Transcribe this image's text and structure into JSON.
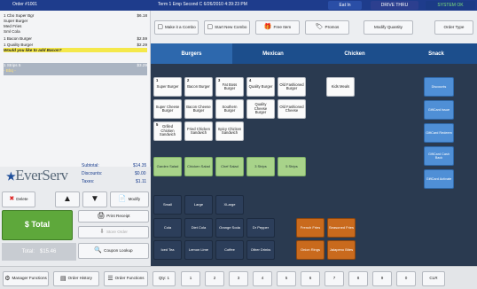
{
  "top": {
    "order_number": "Order #1001",
    "terminal": "Term 1 Emp Second C 6/26/2010 4:39:23 PM",
    "eat_in": "Eat In",
    "drive_thru": "DRIVE THRU",
    "system_ok": "SYSTEM OK"
  },
  "order_lines": [
    {
      "text": "1 Cbo Super Bgr",
      "price": "$6.18"
    },
    {
      "text": "  Super Burger",
      "price": ""
    },
    {
      "text": "  Med Fries",
      "price": ""
    },
    {
      "text": "  Sml Cola",
      "price": ""
    },
    {
      "text": "1 Bacon Burger",
      "price": "$2.59"
    },
    {
      "text": "1 Quality Burger",
      "price": "$2.29"
    },
    {
      "text": "  Would you like to add Bacon?",
      "price": ""
    },
    {
      "text": "1 Strips 5",
      "price": "$3.29"
    },
    {
      "text": "  - Bbq -",
      "price": ""
    }
  ],
  "logo": "EverServ",
  "totals": {
    "subtotal_label": "Subtotal:",
    "subtotal": "$14.35",
    "discounts_label": "Discounts:",
    "discounts": "$0.00",
    "taxes_label": "Taxes:",
    "taxes": "$1.11"
  },
  "left_actions": {
    "delete": "Delete",
    "modify": "Modify",
    "print_receipt": "Print Receipt",
    "store_order": "Store Order",
    "coupon_lookup": "Coupon Lookup",
    "total_button": "$ Total",
    "total_label": "Total:",
    "total_value": "$15.46"
  },
  "toolbar": {
    "make_combo": "Make it a Combo",
    "start_new_combo": "Start New Combo",
    "free_item": "Free Item",
    "promos": "Promos",
    "modify_quantity": "Modify Quantity",
    "order_type": "Order Type"
  },
  "tabs": [
    "Burgers",
    "Mexican",
    "Chicken",
    "Snack"
  ],
  "menu_items": {
    "super_burger": "Super Burger",
    "bacon_burger": "Bacon Burger",
    "fat_boss_burger": "Fat Boss Burger",
    "quality_burger": "Quality Burger",
    "old_fashioned_burger": "Old Fashioned Burger",
    "kids_meals": "Kids Meals",
    "super_cheese": "Super Cheese Burger",
    "bacon_cheese": "Bacon Cheese Burger",
    "southern_burger": "Southern Burger",
    "quality_cheese": "Quality Cheese Burger",
    "old_fashioned_cheese": "Old Fashioned Cheese",
    "grilled_chicken": "Grilled Chicken Sandwich",
    "fried_chicken": "Fried Chicken Sandwich",
    "spicy_chicken": "Spicy Chicken Sandwich",
    "garden_salad": "Garden Salad",
    "chicken_salad": "Chicken Salad",
    "chef_salad": "Chef Salad",
    "strips3": "3 Strips",
    "strips5": "5 Strips",
    "small": "Small",
    "large": "Large",
    "xlarge": "XLarge",
    "cola": "Cola",
    "diet_cola": "Diet Cola",
    "orange_soda": "Orange Soda",
    "dr_pepper": "Dr Pepper",
    "iced_tea": "Iced Tea",
    "lemon_lime": "Lemon Lime",
    "coffee": "Coffee",
    "other_drinks": "Other Drinks",
    "french_fries": "French Fries",
    "seasoned_fries": "Seasoned Fries",
    "onion_rings": "Onion Rings",
    "jalapeno_bites": "Jalapeno Bites"
  },
  "item_numbers": {
    "n1": "1",
    "n2": "2",
    "n3": "3",
    "n4": "4",
    "n5": "5"
  },
  "side_buttons": {
    "discounts": "Discounts",
    "giftcard_issue": "GiftCard Issue",
    "giftcard_redeem": "GiftCard Redeem",
    "giftcard_cash_back": "GiftCard Cash Back",
    "giftcard_activate": "GiftCard Activate"
  },
  "bottom": {
    "manager_functions": "Manager Functions",
    "order_history": "Order History",
    "order_functions": "Order Functions",
    "qty_label": "Qty: 1",
    "keys": [
      "1",
      "2",
      "3",
      "4",
      "5",
      "6",
      "7",
      "8",
      "9",
      "0"
    ],
    "clr": "CLR"
  }
}
